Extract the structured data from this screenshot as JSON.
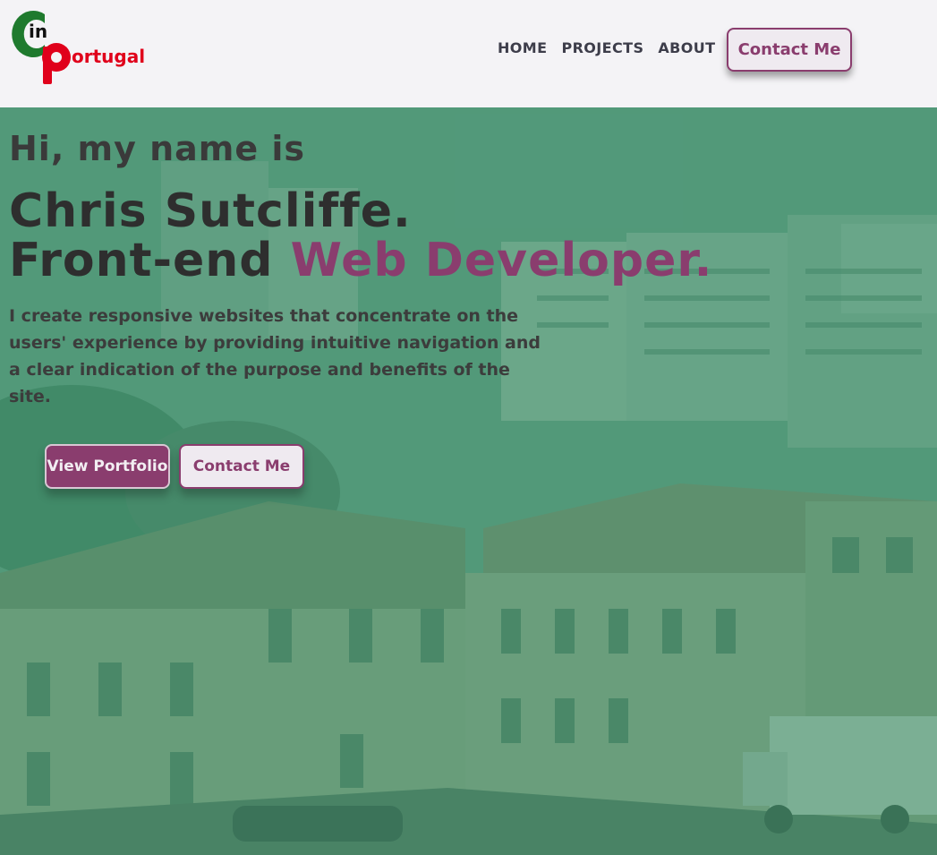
{
  "header": {
    "logo": {
      "line1": "C",
      "line2": "in",
      "line3": "P",
      "line4": "ortugal"
    },
    "nav": [
      {
        "label": "HOME"
      },
      {
        "label": "PROJECTS"
      },
      {
        "label": "ABOUT"
      }
    ],
    "contact_label": "Contact Me"
  },
  "hero": {
    "greeting": "Hi, my name is",
    "name": "Chris Sutcliffe.",
    "role_prefix": "Front-end ",
    "role_accent": "Web Developer.",
    "intro": "I create responsive websites that concentrate on the users' experience by providing intuitive navigation and a clear indication of the purpose and benefits of the site.",
    "btn_portfolio": "View Portfolio",
    "btn_contact": "Contact Me"
  },
  "colors": {
    "accent": "#8a3d6e",
    "overlay": "#3a946e",
    "logo_green": "#1f7a2e",
    "logo_red": "#e0001b"
  }
}
